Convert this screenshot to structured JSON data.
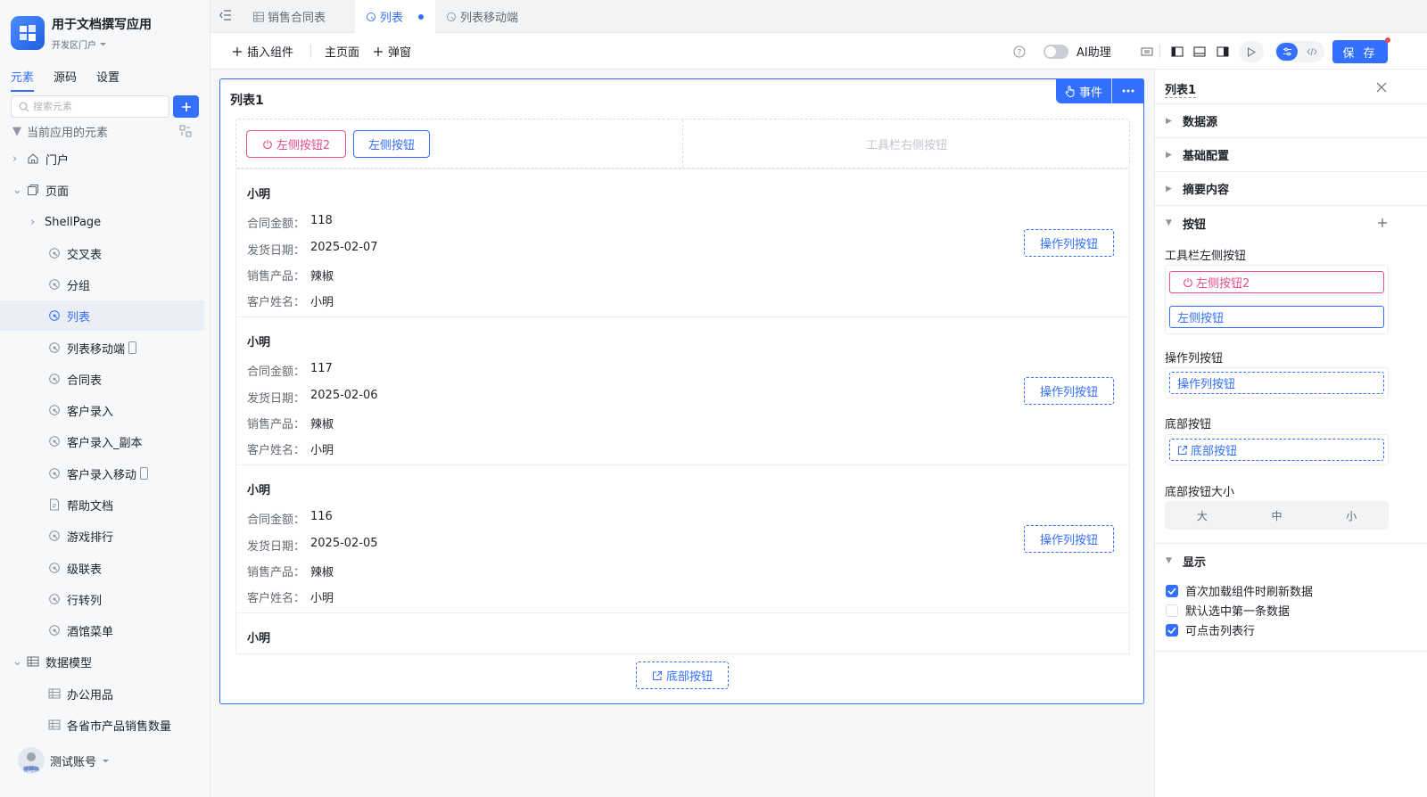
{
  "app": {
    "title": "用于文档撰写应用",
    "env": "开发区门户"
  },
  "sidebar": {
    "tabs": [
      "元素",
      "源码",
      "设置"
    ],
    "search_placeholder": "搜索元素",
    "section_title": "当前应用的元素",
    "items": [
      {
        "label": "门户"
      },
      {
        "label": "页面"
      },
      {
        "label": "ShellPage"
      },
      {
        "label": "交叉表"
      },
      {
        "label": "分组"
      },
      {
        "label": "列表"
      },
      {
        "label": "列表移动端"
      },
      {
        "label": "合同表"
      },
      {
        "label": "客户录入"
      },
      {
        "label": "客户录入_副本"
      },
      {
        "label": "客户录入移动"
      },
      {
        "label": "帮助文档"
      },
      {
        "label": "游戏排行"
      },
      {
        "label": "级联表"
      },
      {
        "label": "行转列"
      },
      {
        "label": "酒馆菜单"
      },
      {
        "label": "数据模型"
      },
      {
        "label": "办公用品"
      },
      {
        "label": "各省市产品销售数量"
      }
    ],
    "account": {
      "name": "测试账号",
      "role": "管理员"
    }
  },
  "tabs": [
    {
      "label": "销售合同表"
    },
    {
      "label": "列表"
    },
    {
      "label": "列表移动端"
    }
  ],
  "toolbar": {
    "insert": "插入组件",
    "main_page": "主页面",
    "popup": "弹窗",
    "ai": "AI助理",
    "save": "保 存"
  },
  "canvas": {
    "title": "列表1",
    "event": "事件",
    "left_btn2": "左侧按钮2",
    "left_btn": "左侧按钮",
    "right_placeholder": "工具栏右侧按钮",
    "op_btn": "操作列按钮",
    "bottom_btn": "底部按钮",
    "field_labels": [
      "合同金额：",
      "发货日期：",
      "销售产品：",
      "客户姓名："
    ],
    "items": [
      {
        "title": "小明",
        "amount": "118",
        "date": "2025-02-07",
        "product": "辣椒",
        "customer": "小明"
      },
      {
        "title": "小明",
        "amount": "117",
        "date": "2025-02-06",
        "product": "辣椒",
        "customer": "小明"
      },
      {
        "title": "小明",
        "amount": "116",
        "date": "2025-02-05",
        "product": "辣椒",
        "customer": "小明"
      },
      {
        "title": "小明"
      }
    ]
  },
  "panel": {
    "title": "列表1",
    "sections": [
      "数据源",
      "基础配置",
      "摘要内容",
      "按钮",
      "显示"
    ],
    "toolbar_left_label": "工具栏左侧按钮",
    "toolbar_left_btn2": "左侧按钮2",
    "toolbar_left_btn": "左侧按钮",
    "op_label": "操作列按钮",
    "op_btn": "操作列按钮",
    "bottom_label": "底部按钮",
    "bottom_btn": "底部按钮",
    "size_label": "底部按钮大小",
    "sizes": [
      "大",
      "中",
      "小"
    ],
    "options": [
      {
        "label": "首次加载组件时刷新数据",
        "checked": true
      },
      {
        "label": "默认选中第一条数据",
        "checked": false
      },
      {
        "label": "可点击列表行",
        "checked": true
      }
    ]
  },
  "colors": {
    "accent": "#3370ff",
    "pink": "#e94f8a",
    "text": "#1f2329",
    "muted": "#646a73"
  }
}
